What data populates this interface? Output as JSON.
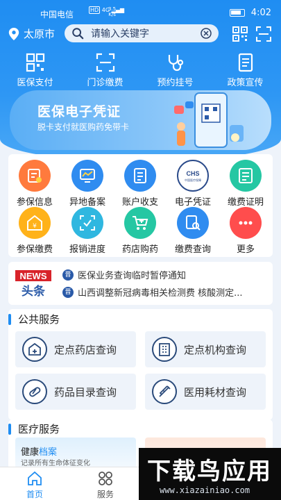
{
  "status": {
    "carrier": "中国电信",
    "hd": "HD",
    "network": "4G",
    "speed_top": "3.5",
    "speed_bottom": "K/s",
    "time": "4:02"
  },
  "location": "太原市",
  "search": {
    "placeholder": "请输入关键字"
  },
  "quick_actions": [
    {
      "label": "医保支付",
      "icon": "qr-code-icon"
    },
    {
      "label": "门诊缴费",
      "icon": "scan-icon"
    },
    {
      "label": "预约挂号",
      "icon": "stethoscope-icon"
    },
    {
      "label": "政策宣传",
      "icon": "document-icon"
    }
  ],
  "banner": {
    "title": "医保电子凭证",
    "subtitle": "脱卡支付就医购药免带卡"
  },
  "grid_items": [
    {
      "label": "参保信息",
      "icon": "insurance-info-icon",
      "color": "#ff7a3d"
    },
    {
      "label": "异地备案",
      "icon": "remote-filing-icon",
      "color": "#2f8cf0"
    },
    {
      "label": "账户收支",
      "icon": "account-icon",
      "color": "#2f8cf0"
    },
    {
      "label": "电子凭证",
      "icon": "chs-logo-icon",
      "color": "#ffffff",
      "badge": "CHS",
      "badge_sub": "中国医疗保障"
    },
    {
      "label": "缴费证明",
      "icon": "certificate-icon",
      "color": "#25c7a3"
    },
    {
      "label": "参保缴费",
      "icon": "payment-icon",
      "color": "#ffb21a"
    },
    {
      "label": "报销进度",
      "icon": "progress-icon",
      "color": "#2fb7e0"
    },
    {
      "label": "药店购药",
      "icon": "cart-icon",
      "color": "#25c7a3"
    },
    {
      "label": "缴费查询",
      "icon": "search-doc-icon",
      "color": "#2f8cf0"
    },
    {
      "label": "更多",
      "icon": "more-icon",
      "color": "#ff4d4d"
    }
  ],
  "news": {
    "logo_top": "NEWS",
    "logo_bottom": "头条",
    "items": [
      "医保业务查询临时暂停通知",
      "山西调整新冠病毒相关检测费 核酸测定..."
    ]
  },
  "public_services": {
    "title": "公共服务",
    "items": [
      {
        "label": "定点药店查询",
        "icon": "pharmacy-icon"
      },
      {
        "label": "定点机构查询",
        "icon": "hospital-building-icon"
      },
      {
        "label": "药品目录查询",
        "icon": "pill-icon"
      },
      {
        "label": "医用耗材查询",
        "icon": "syringe-icon"
      }
    ]
  },
  "medical_services": {
    "title": "医疗服务",
    "health_record_prefix": "健康",
    "health_record_highlight": "档案",
    "health_record_desc": "记录所有生命体征变化"
  },
  "tabs": [
    {
      "label": "首页",
      "active": true
    },
    {
      "label": "服务",
      "active": false
    }
  ],
  "watermark": {
    "text": "下载鸟应用",
    "url": "www.xiazainiao.com"
  },
  "colors": {
    "primary": "#1f8df2",
    "tab_active": "#1f8df2"
  }
}
